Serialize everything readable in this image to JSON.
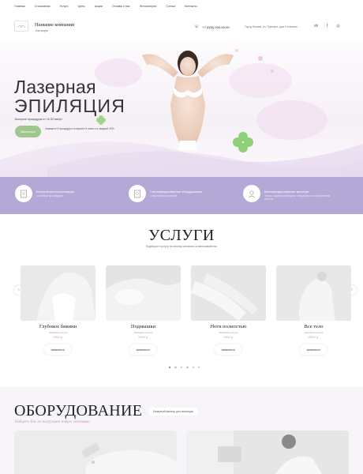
{
  "nav": [
    "Главная",
    "О компании",
    "Услуги",
    "Цены",
    "Акции",
    "Отзывы о нас",
    "Фотогалерея",
    "Статьи",
    "Контакты"
  ],
  "header": {
    "company_name": "Название компании",
    "company_sub": "Эпиляция",
    "phone": "+7 (000) 000-00-00",
    "address": "Город Москва, ул. Примера, дом 0 в вашем …"
  },
  "hero": {
    "title_line1": "Лазерная",
    "title_line2": "ЭПИЛЯЦИЯ",
    "subtitle": "Быстрые процедуры от 10-30 минут",
    "button": "Записаться",
    "promo": "Закажите 5 процедур и получите 6 сеанс со скидкой 40%"
  },
  "features": [
    {
      "title": "Бесплатная консультация",
      "sub": "по любым процедурам",
      "icon": "document-icon"
    },
    {
      "title": "Сертифицированное оборудование",
      "sub": "с гарантией результата",
      "icon": "certificate-icon"
    },
    {
      "title": "Квалифицированные мастера",
      "sub": "Только профессиональные специалисты с многолетним опытом"
    }
  ],
  "services": {
    "title": "УСЛУГИ",
    "subtitle": "Подберите услугу по своему желанию и записывайтесь",
    "items": [
      {
        "name": "Глубокое бикини",
        "desc": "Описание услуги",
        "price": "1900 р."
      },
      {
        "name": "Подмышки",
        "desc": "Описание услуги",
        "price": "1900 р."
      },
      {
        "name": "Ноги полностью",
        "desc": "Описание услуги",
        "price": "1900 р."
      },
      {
        "name": "Все тело",
        "desc": "Описание услуги",
        "price": "2500 р."
      }
    ],
    "button": "записаться"
  },
  "equipment": {
    "title": "ОБОРУДОВАНИЕ",
    "note": "Лазерный фильтр для эпиляции",
    "link": "Найдите Вас не нагружаем новую эпиляцию"
  },
  "colors": {
    "accent_green": "#9fc790",
    "band": "#b4a8d6",
    "price_pink": "#d39aa3"
  }
}
